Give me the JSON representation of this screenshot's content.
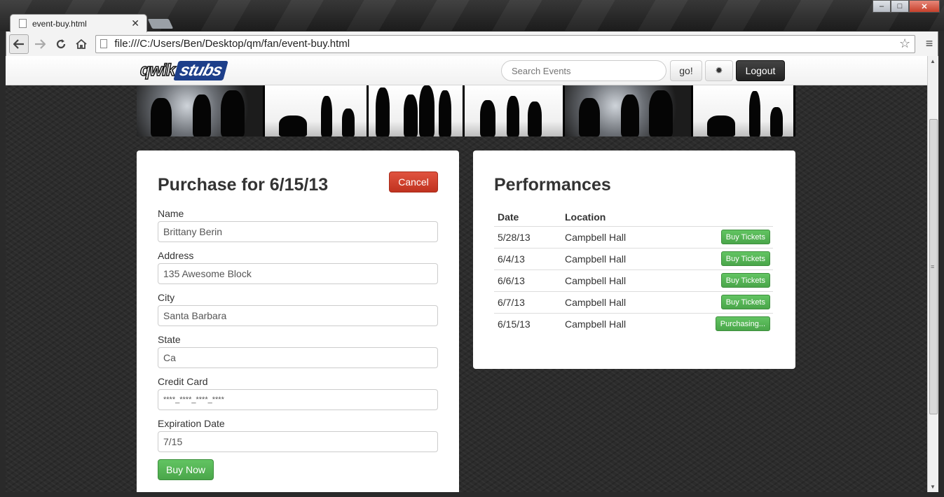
{
  "browser": {
    "tab_title": "event-buy.html",
    "tab_close": "✕",
    "url": "file:///C:/Users/Ben/Desktop/qm/fan/event-buy.html",
    "win_min": "‒",
    "win_max": "□",
    "win_close": "✕"
  },
  "navbar": {
    "logo_part1": "qwik",
    "logo_part2": "stubs",
    "search_placeholder": "Search Events",
    "go_label": "go!",
    "gear_icon": "✹",
    "logout_label": "Logout"
  },
  "purchase": {
    "title": "Purchase for 6/15/13",
    "cancel_label": "Cancel",
    "fields": [
      {
        "label": "Name",
        "value": "Brittany Berin"
      },
      {
        "label": "Address",
        "value": "135 Awesome Block"
      },
      {
        "label": "City",
        "value": "Santa Barbara"
      },
      {
        "label": "State",
        "value": "Ca"
      },
      {
        "label": "Credit Card",
        "value": "****_****_****_****"
      },
      {
        "label": "Expiration Date",
        "value": "7/15"
      }
    ],
    "buy_label": "Buy Now"
  },
  "performances": {
    "title": "Performances",
    "col_date": "Date",
    "col_location": "Location",
    "rows": [
      {
        "date": "5/28/13",
        "location": "Campbell Hall",
        "action": "Buy Tickets"
      },
      {
        "date": "6/4/13",
        "location": "Campbell Hall",
        "action": "Buy Tickets"
      },
      {
        "date": "6/6/13",
        "location": "Campbell Hall",
        "action": "Buy Tickets"
      },
      {
        "date": "6/7/13",
        "location": "Campbell Hall",
        "action": "Buy Tickets"
      },
      {
        "date": "6/15/13",
        "location": "Campbell Hall",
        "action": "Purchasing..."
      }
    ]
  }
}
